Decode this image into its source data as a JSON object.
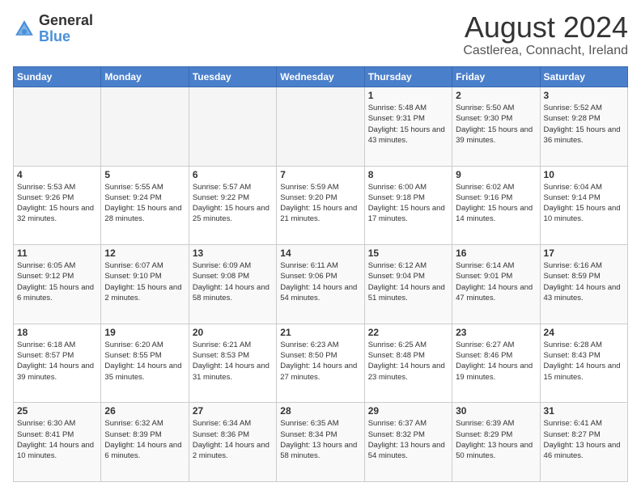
{
  "header": {
    "logo_general": "General",
    "logo_blue": "Blue",
    "month_title": "August 2024",
    "location": "Castlerea, Connacht, Ireland"
  },
  "weekdays": [
    "Sunday",
    "Monday",
    "Tuesday",
    "Wednesday",
    "Thursday",
    "Friday",
    "Saturday"
  ],
  "weeks": [
    [
      {
        "day": "",
        "sunrise": "",
        "sunset": "",
        "daylight": ""
      },
      {
        "day": "",
        "sunrise": "",
        "sunset": "",
        "daylight": ""
      },
      {
        "day": "",
        "sunrise": "",
        "sunset": "",
        "daylight": ""
      },
      {
        "day": "",
        "sunrise": "",
        "sunset": "",
        "daylight": ""
      },
      {
        "day": "1",
        "sunrise": "Sunrise: 5:48 AM",
        "sunset": "Sunset: 9:31 PM",
        "daylight": "Daylight: 15 hours and 43 minutes."
      },
      {
        "day": "2",
        "sunrise": "Sunrise: 5:50 AM",
        "sunset": "Sunset: 9:30 PM",
        "daylight": "Daylight: 15 hours and 39 minutes."
      },
      {
        "day": "3",
        "sunrise": "Sunrise: 5:52 AM",
        "sunset": "Sunset: 9:28 PM",
        "daylight": "Daylight: 15 hours and 36 minutes."
      }
    ],
    [
      {
        "day": "4",
        "sunrise": "Sunrise: 5:53 AM",
        "sunset": "Sunset: 9:26 PM",
        "daylight": "Daylight: 15 hours and 32 minutes."
      },
      {
        "day": "5",
        "sunrise": "Sunrise: 5:55 AM",
        "sunset": "Sunset: 9:24 PM",
        "daylight": "Daylight: 15 hours and 28 minutes."
      },
      {
        "day": "6",
        "sunrise": "Sunrise: 5:57 AM",
        "sunset": "Sunset: 9:22 PM",
        "daylight": "Daylight: 15 hours and 25 minutes."
      },
      {
        "day": "7",
        "sunrise": "Sunrise: 5:59 AM",
        "sunset": "Sunset: 9:20 PM",
        "daylight": "Daylight: 15 hours and 21 minutes."
      },
      {
        "day": "8",
        "sunrise": "Sunrise: 6:00 AM",
        "sunset": "Sunset: 9:18 PM",
        "daylight": "Daylight: 15 hours and 17 minutes."
      },
      {
        "day": "9",
        "sunrise": "Sunrise: 6:02 AM",
        "sunset": "Sunset: 9:16 PM",
        "daylight": "Daylight: 15 hours and 14 minutes."
      },
      {
        "day": "10",
        "sunrise": "Sunrise: 6:04 AM",
        "sunset": "Sunset: 9:14 PM",
        "daylight": "Daylight: 15 hours and 10 minutes."
      }
    ],
    [
      {
        "day": "11",
        "sunrise": "Sunrise: 6:05 AM",
        "sunset": "Sunset: 9:12 PM",
        "daylight": "Daylight: 15 hours and 6 minutes."
      },
      {
        "day": "12",
        "sunrise": "Sunrise: 6:07 AM",
        "sunset": "Sunset: 9:10 PM",
        "daylight": "Daylight: 15 hours and 2 minutes."
      },
      {
        "day": "13",
        "sunrise": "Sunrise: 6:09 AM",
        "sunset": "Sunset: 9:08 PM",
        "daylight": "Daylight: 14 hours and 58 minutes."
      },
      {
        "day": "14",
        "sunrise": "Sunrise: 6:11 AM",
        "sunset": "Sunset: 9:06 PM",
        "daylight": "Daylight: 14 hours and 54 minutes."
      },
      {
        "day": "15",
        "sunrise": "Sunrise: 6:12 AM",
        "sunset": "Sunset: 9:04 PM",
        "daylight": "Daylight: 14 hours and 51 minutes."
      },
      {
        "day": "16",
        "sunrise": "Sunrise: 6:14 AM",
        "sunset": "Sunset: 9:01 PM",
        "daylight": "Daylight: 14 hours and 47 minutes."
      },
      {
        "day": "17",
        "sunrise": "Sunrise: 6:16 AM",
        "sunset": "Sunset: 8:59 PM",
        "daylight": "Daylight: 14 hours and 43 minutes."
      }
    ],
    [
      {
        "day": "18",
        "sunrise": "Sunrise: 6:18 AM",
        "sunset": "Sunset: 8:57 PM",
        "daylight": "Daylight: 14 hours and 39 minutes."
      },
      {
        "day": "19",
        "sunrise": "Sunrise: 6:20 AM",
        "sunset": "Sunset: 8:55 PM",
        "daylight": "Daylight: 14 hours and 35 minutes."
      },
      {
        "day": "20",
        "sunrise": "Sunrise: 6:21 AM",
        "sunset": "Sunset: 8:53 PM",
        "daylight": "Daylight: 14 hours and 31 minutes."
      },
      {
        "day": "21",
        "sunrise": "Sunrise: 6:23 AM",
        "sunset": "Sunset: 8:50 PM",
        "daylight": "Daylight: 14 hours and 27 minutes."
      },
      {
        "day": "22",
        "sunrise": "Sunrise: 6:25 AM",
        "sunset": "Sunset: 8:48 PM",
        "daylight": "Daylight: 14 hours and 23 minutes."
      },
      {
        "day": "23",
        "sunrise": "Sunrise: 6:27 AM",
        "sunset": "Sunset: 8:46 PM",
        "daylight": "Daylight: 14 hours and 19 minutes."
      },
      {
        "day": "24",
        "sunrise": "Sunrise: 6:28 AM",
        "sunset": "Sunset: 8:43 PM",
        "daylight": "Daylight: 14 hours and 15 minutes."
      }
    ],
    [
      {
        "day": "25",
        "sunrise": "Sunrise: 6:30 AM",
        "sunset": "Sunset: 8:41 PM",
        "daylight": "Daylight: 14 hours and 10 minutes."
      },
      {
        "day": "26",
        "sunrise": "Sunrise: 6:32 AM",
        "sunset": "Sunset: 8:39 PM",
        "daylight": "Daylight: 14 hours and 6 minutes."
      },
      {
        "day": "27",
        "sunrise": "Sunrise: 6:34 AM",
        "sunset": "Sunset: 8:36 PM",
        "daylight": "Daylight: 14 hours and 2 minutes."
      },
      {
        "day": "28",
        "sunrise": "Sunrise: 6:35 AM",
        "sunset": "Sunset: 8:34 PM",
        "daylight": "Daylight: 13 hours and 58 minutes."
      },
      {
        "day": "29",
        "sunrise": "Sunrise: 6:37 AM",
        "sunset": "Sunset: 8:32 PM",
        "daylight": "Daylight: 13 hours and 54 minutes."
      },
      {
        "day": "30",
        "sunrise": "Sunrise: 6:39 AM",
        "sunset": "Sunset: 8:29 PM",
        "daylight": "Daylight: 13 hours and 50 minutes."
      },
      {
        "day": "31",
        "sunrise": "Sunrise: 6:41 AM",
        "sunset": "Sunset: 8:27 PM",
        "daylight": "Daylight: 13 hours and 46 minutes."
      }
    ]
  ]
}
